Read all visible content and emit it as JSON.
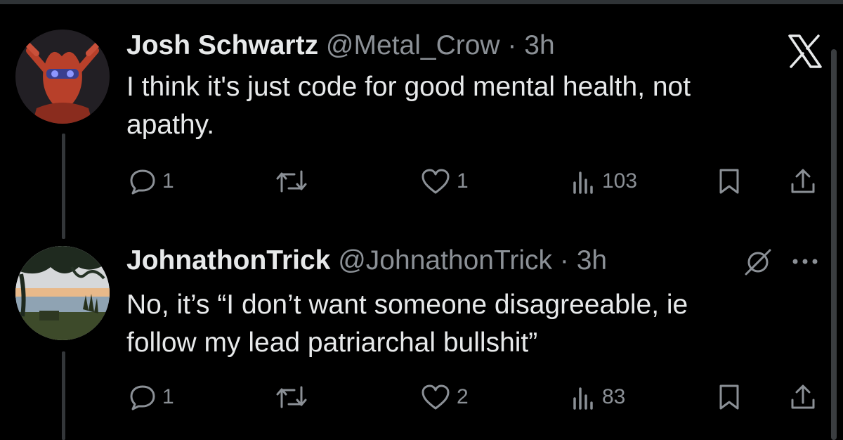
{
  "tweets": [
    {
      "name": "Josh Schwartz",
      "handle": "@Metal_Crow",
      "separator": "·",
      "time": "3h",
      "text_lines": [
        "I think it's just code for good mental health, not",
        "apathy."
      ],
      "replies": "1",
      "retweets": "",
      "likes": "1",
      "views": "103"
    },
    {
      "name": "JohnathonTrick",
      "handle": "@JohnathonTrick",
      "separator": "·",
      "time": "3h",
      "text_lines": [
        "No, it’s “I don’t want someone disagreeable, ie",
        "follow my lead patriarchal bullshit”"
      ],
      "replies": "1",
      "retweets": "",
      "likes": "2",
      "views": "83"
    }
  ],
  "icons": {
    "close": "x-logo-icon",
    "grok": "grok-icon",
    "more": "more-icon",
    "reply": "reply-icon",
    "retweet": "retweet-icon",
    "like": "heart-icon",
    "views": "views-icon",
    "bookmark": "bookmark-icon",
    "share": "share-icon"
  },
  "colors": {
    "background": "#000000",
    "primary_text": "#e7e9ea",
    "secondary_text": "#8b9096",
    "thread_line": "#333639"
  }
}
